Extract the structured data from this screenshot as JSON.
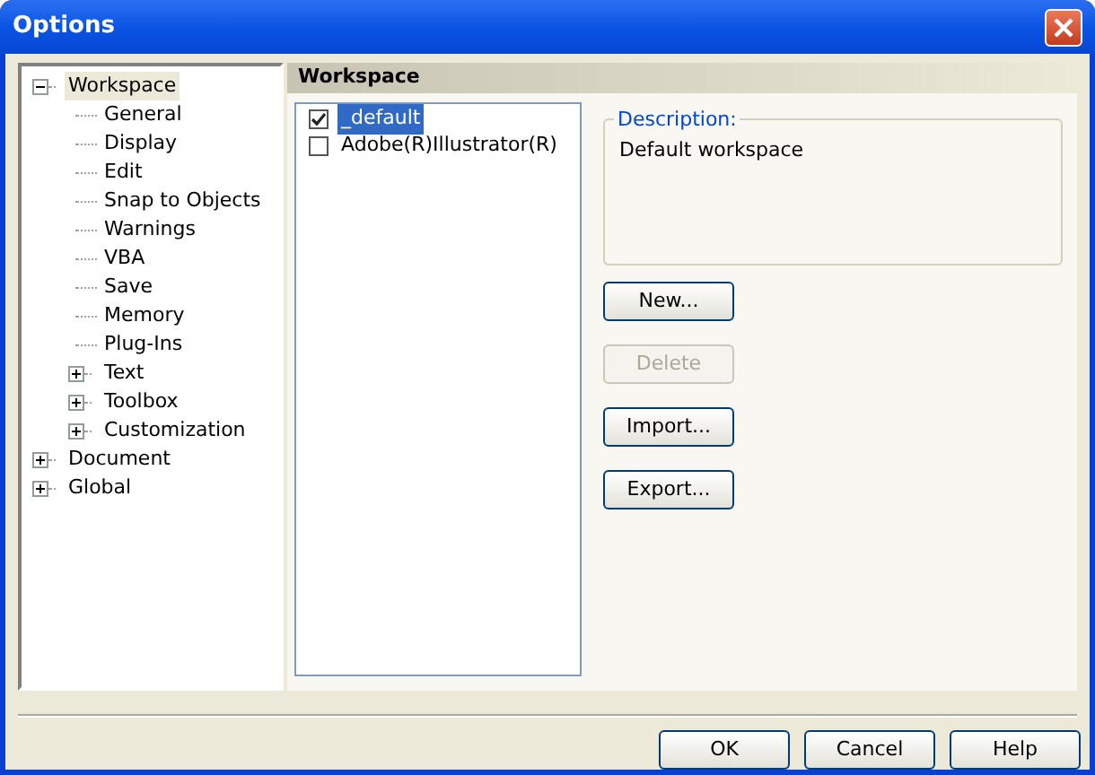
{
  "window": {
    "title": "Options"
  },
  "tree": [
    {
      "label": "Workspace",
      "selected": true,
      "expanded": true,
      "children": [
        {
          "label": "General",
          "selected": false
        },
        {
          "label": "Display",
          "selected": false
        },
        {
          "label": "Edit",
          "selected": false
        },
        {
          "label": "Snap to Objects",
          "selected": false
        },
        {
          "label": "Warnings",
          "selected": false
        },
        {
          "label": "VBA",
          "selected": false
        },
        {
          "label": "Save",
          "selected": false
        },
        {
          "label": "Memory",
          "selected": false
        },
        {
          "label": "Plug-Ins",
          "selected": false
        },
        {
          "label": "Text",
          "selected": false,
          "expanded": false
        },
        {
          "label": "Toolbox",
          "selected": false,
          "expanded": false
        },
        {
          "label": "Customization",
          "selected": false,
          "expanded": false
        }
      ]
    },
    {
      "label": "Document",
      "selected": false,
      "expanded": false
    },
    {
      "label": "Global",
      "selected": false,
      "expanded": false
    }
  ],
  "panel": {
    "title": "Workspace",
    "workspaces": [
      {
        "label": "_default",
        "checked": true,
        "selected": true
      },
      {
        "label": "Adobe(R)Illustrator(R)",
        "checked": false,
        "selected": false
      }
    ],
    "description": {
      "label": "Description:",
      "value": "Default workspace"
    },
    "buttons": [
      {
        "label": "New...",
        "disabled": false
      },
      {
        "label": "Delete",
        "disabled": true
      },
      {
        "label": "Import...",
        "disabled": false
      },
      {
        "label": "Export...",
        "disabled": false
      }
    ]
  },
  "dialog_buttons": [
    {
      "label": "OK"
    },
    {
      "label": "Cancel"
    },
    {
      "label": "Help"
    }
  ]
}
